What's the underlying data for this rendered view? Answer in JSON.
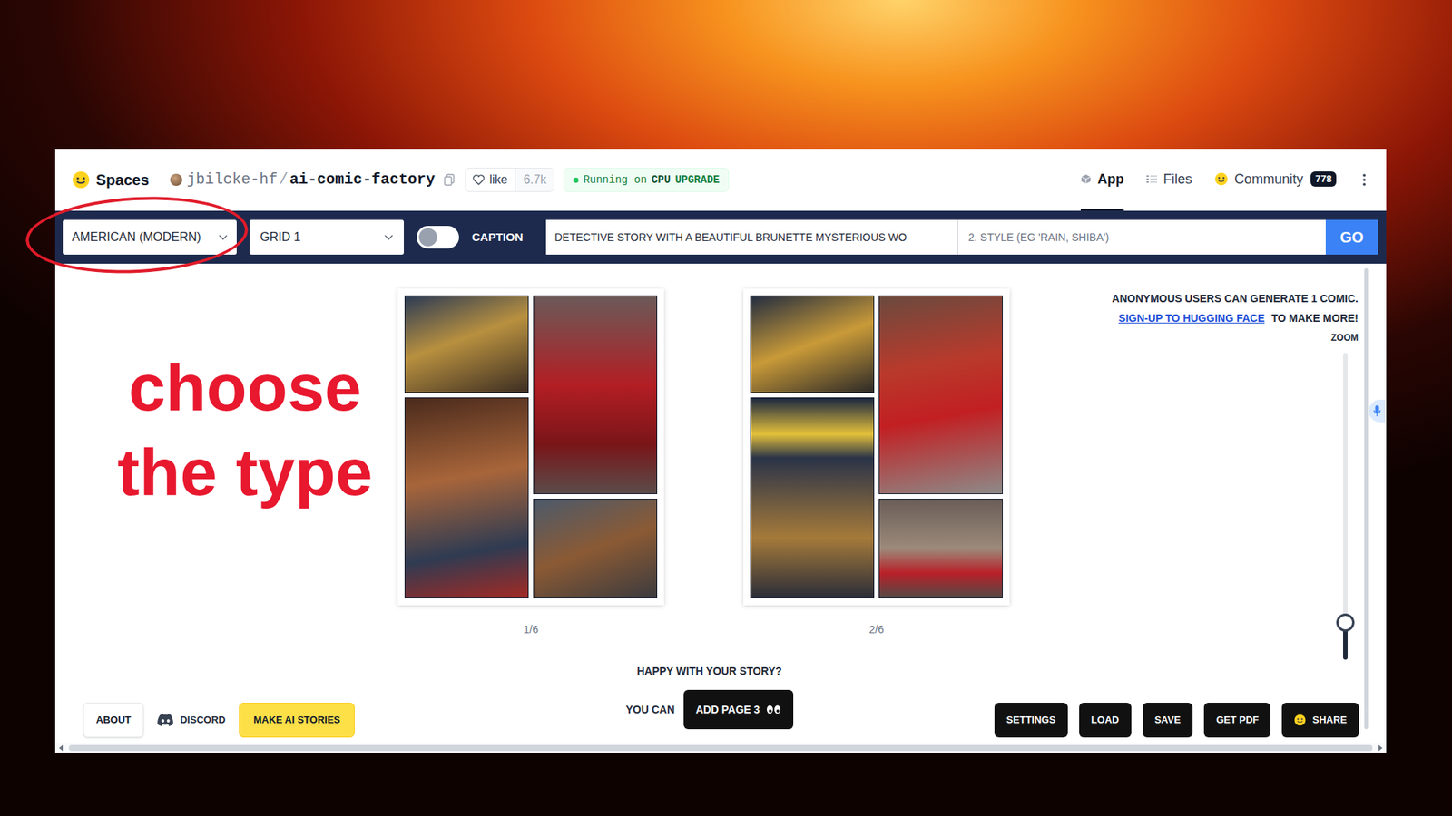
{
  "overlay": {
    "caption": "choose the type"
  },
  "header": {
    "brand": "Spaces",
    "owner": "jbilcke-hf",
    "separator": "/",
    "repo": "ai-comic-factory",
    "like": {
      "label": "like",
      "count": "6.7k"
    },
    "status": {
      "text": "Running on",
      "hardware": "CPU",
      "action": "UPGRADE"
    },
    "tabs": [
      {
        "label": "App",
        "selected": true,
        "kind": "app",
        "badge": ""
      },
      {
        "label": "Files",
        "selected": false,
        "kind": "files",
        "badge": ""
      },
      {
        "label": "Community",
        "selected": false,
        "kind": "community",
        "badge": "778"
      }
    ]
  },
  "toolbar": {
    "style": "AMERICAN (MODERN)",
    "layout": "GRID 1",
    "caption_toggle": {
      "label": "CAPTION",
      "on": false
    },
    "prompt": "DETECTIVE STORY WITH A BEAUTIFUL BRUNETTE MYSTERIOUS WO",
    "style_placeholder": "2. STYLE (EG 'RAIN, SHIBA')",
    "go": "GO"
  },
  "pages": [
    {
      "label": "1/6"
    },
    {
      "label": "2/6"
    }
  ],
  "notice": {
    "text": "ANONYMOUS USERS CAN GENERATE 1 COMIC.",
    "link": "SIGN-UP TO HUGGING FACE",
    "suffix": "TO MAKE MORE!"
  },
  "zoom": {
    "label": "ZOOM",
    "level": 0.12
  },
  "next": {
    "question": "HAPPY WITH YOUR STORY?",
    "lead": "YOU CAN",
    "button": "ADD PAGE 3"
  },
  "footer_left": [
    {
      "label": "ABOUT",
      "kind": "plain"
    },
    {
      "label": "DISCORD",
      "kind": "icon"
    },
    {
      "label": "MAKE AI STORIES",
      "kind": "highlight"
    }
  ],
  "footer_right": [
    {
      "label": "SETTINGS",
      "kind": "dark"
    },
    {
      "label": "LOAD",
      "kind": "dark"
    },
    {
      "label": "SAVE",
      "kind": "dark"
    },
    {
      "label": "GET PDF",
      "kind": "dark"
    },
    {
      "label": "SHARE",
      "kind": "share"
    }
  ]
}
